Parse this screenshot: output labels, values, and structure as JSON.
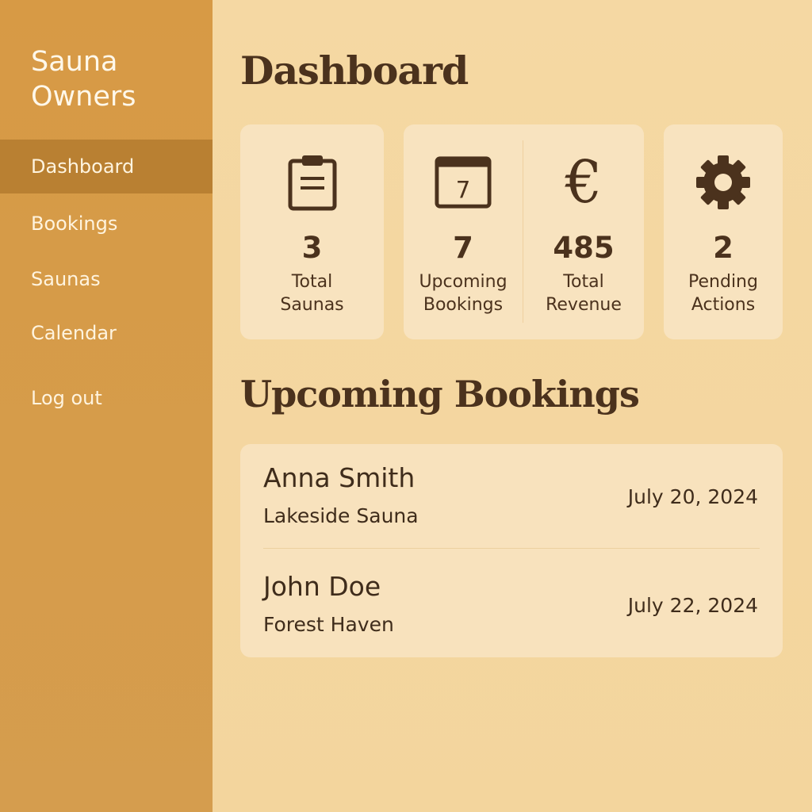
{
  "sidebar": {
    "brand_line1": "Sauna",
    "brand_line2": "Owners",
    "items": [
      {
        "label": "Dashboard",
        "active": true
      },
      {
        "label": "Bookings",
        "active": false
      },
      {
        "label": "Saunas",
        "active": false
      },
      {
        "label": "Calendar",
        "active": false
      },
      {
        "label": "Log out",
        "active": false
      }
    ]
  },
  "main": {
    "title": "Dashboard",
    "stats": [
      {
        "icon": "clipboard-icon",
        "value": "3",
        "label": "Total\nSaunas"
      },
      {
        "icon": "calendar-icon",
        "icon_text": "7",
        "value": "7",
        "label": "Upcoming\nBookings"
      },
      {
        "icon": "euro-icon",
        "icon_text": "€",
        "value": "485",
        "label": "Total\nRevenue"
      },
      {
        "icon": "gear-icon",
        "value": "2",
        "label": "Pending\nActions"
      }
    ],
    "section_title": "Upcoming Bookings",
    "bookings": [
      {
        "name": "Anna Smith",
        "sauna": "Lakeside Sauna",
        "date": "July 20, 2024"
      },
      {
        "name": "John Doe",
        "sauna": "Forest Haven",
        "date": "July 22, 2024"
      }
    ]
  },
  "colors": {
    "sidebar": "#d69b48",
    "sidebar_active": "#b98032",
    "background": "#f5d8a3",
    "card": "#f8e3bf",
    "text_dark": "#4b321d"
  }
}
